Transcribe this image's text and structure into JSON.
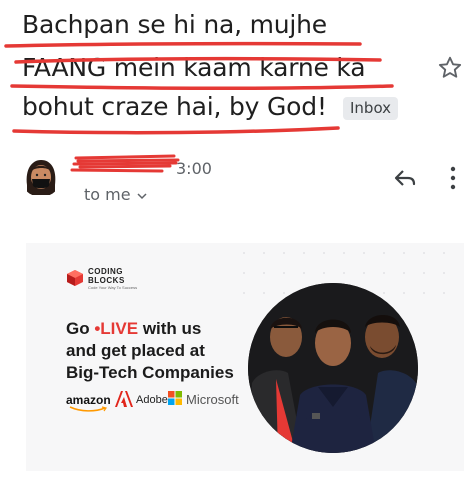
{
  "email": {
    "subject_lines": [
      "Bachpan se hi na, mujhe",
      "FAANG mein kaam karne ka",
      "bohut craze hai, by God!"
    ],
    "label_badge": "Inbox",
    "sender_time": "3:00",
    "recipient_text": "to me",
    "icons": {
      "star": "star-outline-icon",
      "reply": "reply-icon",
      "more": "more-vert-icon",
      "recipient_expand": "chevron-down-icon"
    },
    "redaction_color": "#e53935"
  },
  "banner": {
    "brand_line1": "CODING",
    "brand_line2": "BLOCKS",
    "brand_tagline": "Code Your Way To Success",
    "headline_go": "Go",
    "headline_live": "LIVE",
    "headline_rest1": "with us",
    "headline_line2": "and get placed at",
    "headline_line3": "Big-Tech Companies",
    "companies": [
      "amazon",
      "Adobe",
      "Microsoft"
    ],
    "accent_color": "#e53935"
  }
}
